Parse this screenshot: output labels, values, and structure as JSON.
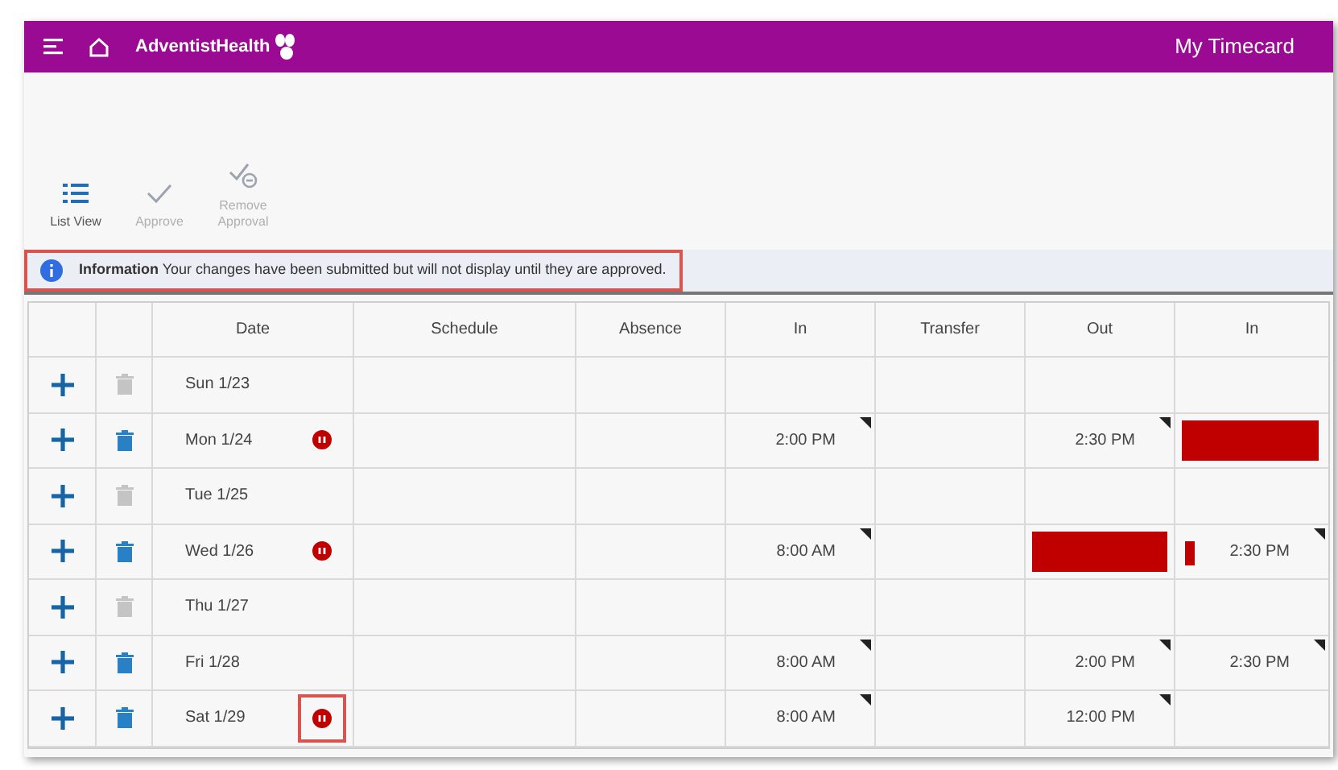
{
  "header": {
    "brand": "AdventistHealth",
    "title": "My Timecard"
  },
  "toolbar": [
    {
      "kind": "list",
      "label": "List View",
      "disabled": false
    },
    {
      "kind": "approve",
      "label": "Approve",
      "disabled": true
    },
    {
      "kind": "remove",
      "label": "Remove Approval",
      "disabled": true
    }
  ],
  "info": {
    "label": "Information",
    "message": "Your changes have been submitted but will not display until they are approved.",
    "highlighted": true
  },
  "table": {
    "columns": [
      "Date",
      "Schedule",
      "Absence",
      "In",
      "Transfer",
      "Out",
      "In"
    ],
    "rows": [
      {
        "trash_enabled": false,
        "cells": [
          {
            "kind": "date",
            "text": "Sun 1/23",
            "error": false,
            "error_highlighted": false
          },
          {
            "kind": "empty"
          },
          {
            "kind": "empty"
          },
          {
            "kind": "empty"
          },
          {
            "kind": "empty"
          },
          {
            "kind": "empty"
          },
          {
            "kind": "empty"
          }
        ]
      },
      {
        "trash_enabled": true,
        "cells": [
          {
            "kind": "date",
            "text": "Mon 1/24",
            "error": true,
            "error_highlighted": false
          },
          {
            "kind": "empty"
          },
          {
            "kind": "empty"
          },
          {
            "kind": "time",
            "text": "2:00 PM",
            "flagged": true
          },
          {
            "kind": "empty"
          },
          {
            "kind": "time",
            "text": "2:30 PM",
            "flagged": true
          },
          {
            "kind": "redacted"
          }
        ]
      },
      {
        "trash_enabled": false,
        "cells": [
          {
            "kind": "date",
            "text": "Tue 1/25",
            "error": false,
            "error_highlighted": false
          },
          {
            "kind": "empty"
          },
          {
            "kind": "empty"
          },
          {
            "kind": "empty"
          },
          {
            "kind": "empty"
          },
          {
            "kind": "empty"
          },
          {
            "kind": "empty"
          }
        ]
      },
      {
        "trash_enabled": true,
        "cells": [
          {
            "kind": "date",
            "text": "Wed 1/26",
            "error": true,
            "error_highlighted": false
          },
          {
            "kind": "empty"
          },
          {
            "kind": "empty"
          },
          {
            "kind": "time",
            "text": "8:00 AM",
            "flagged": true
          },
          {
            "kind": "empty"
          },
          {
            "kind": "redacted"
          },
          {
            "kind": "time",
            "text": "2:30 PM",
            "flagged": true,
            "alert": true
          }
        ]
      },
      {
        "trash_enabled": false,
        "cells": [
          {
            "kind": "date",
            "text": "Thu 1/27",
            "error": false,
            "error_highlighted": false
          },
          {
            "kind": "empty"
          },
          {
            "kind": "empty"
          },
          {
            "kind": "empty"
          },
          {
            "kind": "empty"
          },
          {
            "kind": "empty"
          },
          {
            "kind": "empty"
          }
        ]
      },
      {
        "trash_enabled": true,
        "cells": [
          {
            "kind": "date",
            "text": "Fri 1/28",
            "error": false,
            "error_highlighted": false
          },
          {
            "kind": "empty"
          },
          {
            "kind": "empty"
          },
          {
            "kind": "time",
            "text": "8:00 AM",
            "flagged": true
          },
          {
            "kind": "empty"
          },
          {
            "kind": "time",
            "text": "2:00 PM",
            "flagged": true
          },
          {
            "kind": "time",
            "text": "2:30 PM",
            "flagged": true
          }
        ]
      },
      {
        "trash_enabled": true,
        "cells": [
          {
            "kind": "date",
            "text": "Sat 1/29",
            "error": true,
            "error_highlighted": true
          },
          {
            "kind": "empty"
          },
          {
            "kind": "empty"
          },
          {
            "kind": "time",
            "text": "8:00 AM",
            "flagged": true
          },
          {
            "kind": "empty"
          },
          {
            "kind": "time",
            "text": "12:00 PM",
            "flagged": true
          },
          {
            "kind": "empty"
          }
        ]
      }
    ]
  }
}
